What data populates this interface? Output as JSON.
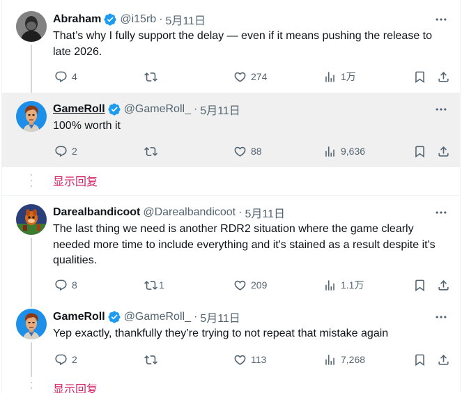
{
  "tweets": [
    {
      "name": "Abraham",
      "handle": "@i15rb",
      "separator": "·",
      "date": "5月11日",
      "text": "That’s why I fully support the delay — even if it means pushing the release to late 2026.",
      "replies": "4",
      "retweets": "",
      "likes": "274",
      "views": "1万",
      "avatar_icon": "bw-portrait-avatar"
    },
    {
      "name": "GameRoll",
      "handle": "@GameRoll_",
      "separator": "·",
      "date": "5月11日",
      "text": "100% worth it",
      "replies": "2",
      "retweets": "",
      "likes": "88",
      "views": "9,636",
      "avatar_icon": "cartoon-man-avatar"
    },
    {
      "name": "Darealbandicoot",
      "handle": "@Darealbandicoot",
      "separator": "·",
      "date": "5月11日",
      "text": "The last thing we need is another RDR2 situation where the game clearly needed more time to include everything and it's stained as a result despite it's qualities.",
      "replies": "8",
      "retweets": "1",
      "likes": "209",
      "views": "1.1万",
      "avatar_icon": "bandicoot-avatar"
    },
    {
      "name": "GameRoll",
      "handle": "@GameRoll_",
      "separator": "·",
      "date": "5月11日",
      "text": "Yep exactly, thankfully they’re trying to not repeat that mistake again",
      "replies": "2",
      "retweets": "",
      "likes": "113",
      "views": "7,268",
      "avatar_icon": "cartoon-man-avatar"
    }
  ],
  "show_replies_label": "显示回复",
  "colors": {
    "text": "#0f1419",
    "secondary": "#536471",
    "verified": "#1d9bf0",
    "show_replies": "#d6246a",
    "highlight_bg": "#f0f0f0"
  }
}
